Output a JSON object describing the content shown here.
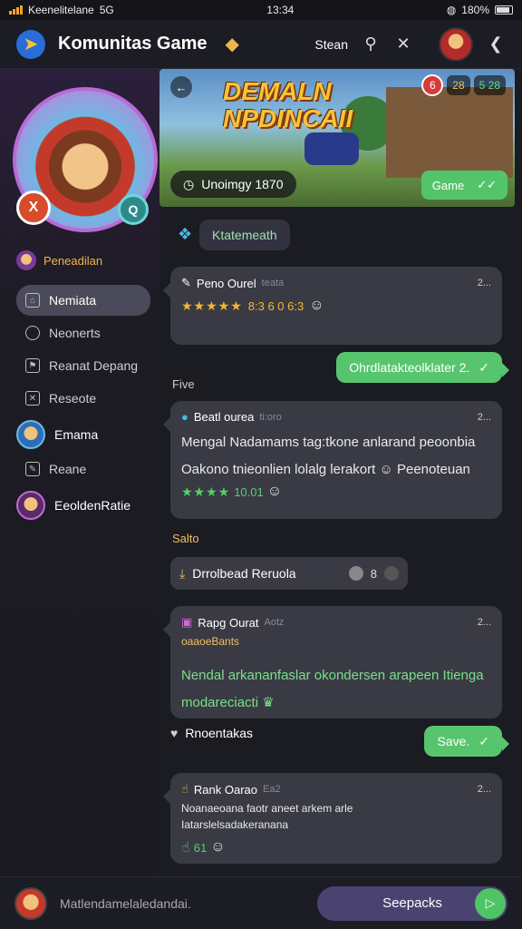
{
  "statusbar": {
    "carrier": "Keenelitelane",
    "network": "5G",
    "time": "13:34",
    "battery": "180%"
  },
  "header": {
    "title": "Komunitas Game",
    "right_text": "Stean"
  },
  "sidebar": {
    "badge_x": "X",
    "badge_q": "Q",
    "profile_name": "Peneadilan",
    "nav": [
      {
        "label": "Nemiata",
        "icon": "home-icon",
        "active": true
      },
      {
        "label": "Neonerts",
        "icon": "search-icon"
      },
      {
        "label": "Reanat Depang",
        "icon": "flag-icon"
      },
      {
        "label": "Reseote",
        "icon": "shuffle-icon"
      }
    ],
    "users": [
      {
        "label": "Emama"
      },
      {
        "label": "Reane"
      },
      {
        "label": "EeoldenRatie"
      }
    ]
  },
  "banner": {
    "title_line1": "DEMALN",
    "title_line2": "NPDINCAII",
    "back_icon": "←",
    "stat1": "6",
    "stat2": "28",
    "stat3": "5 28",
    "pill_text": "Unoimgy 1870",
    "button_label": "Game"
  },
  "chip": {
    "label": "Ktatemeath"
  },
  "posts": [
    {
      "author": "Peno Ourel",
      "sub": "teata",
      "menu": "2...",
      "line": "8:3 6 0 6:3"
    },
    {
      "author": "Beatl ourea",
      "sub": "ti:oro",
      "menu": "2...",
      "text1": "Mengal Nadamams tag:tkone anlarand peoonbia",
      "text2": "Oakono tnieonlien lolalg lerakort",
      "tail": "Peenoteuan",
      "line": "10.01"
    },
    {
      "author": "Rapg Ourat",
      "sub": "Aotz",
      "menu": "2...",
      "small": "oaaoeBants",
      "text1": "Nendal arkananfaslar okondersen arapeen Itienga",
      "text2": "modareciacti"
    },
    {
      "author": "Rank Oarao",
      "sub": "Ea2",
      "menu": "2...",
      "small1": "Noanaeoana faotr aneet arkem arle",
      "small2": "Iatarslelsadakeranana",
      "line": "61"
    }
  ],
  "replies": [
    {
      "label": "Ohrdlatakteolklater 2."
    },
    {
      "label": "Save."
    }
  ],
  "labels": {
    "five": "Five",
    "sale": "Salto"
  },
  "download": {
    "label": "Drrolbead Reruola",
    "count": "8"
  },
  "reaction": {
    "label": "Rnoentakas"
  },
  "bottom": {
    "placeholder": "Matlendamelaledandai.",
    "button": "Seepacks"
  },
  "colors": {
    "accent_green": "#57c56d",
    "accent_gold": "#f0c060",
    "bg": "#1b1b22"
  }
}
